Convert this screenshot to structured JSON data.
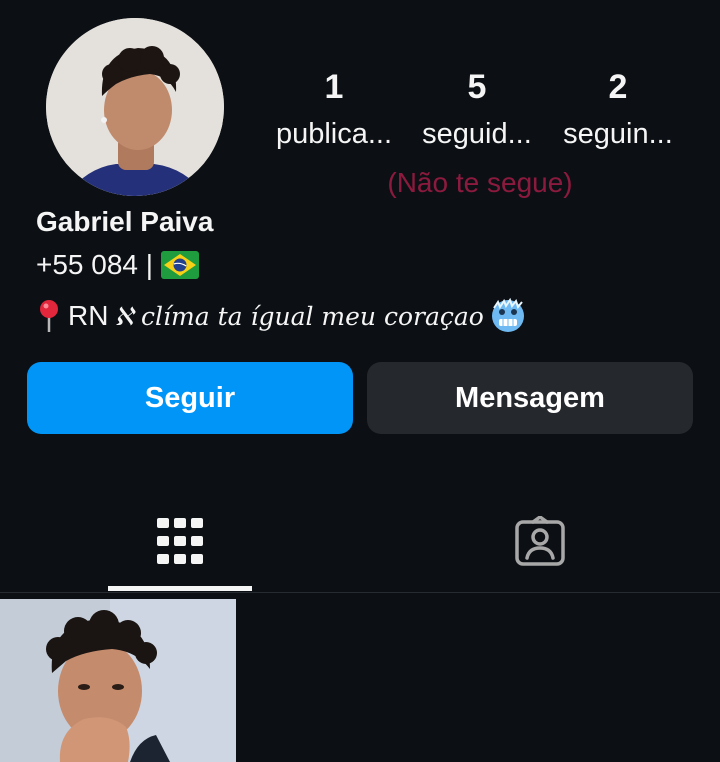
{
  "profile": {
    "avatar_alt": "profile-photo",
    "name": "Gabriel Paiva",
    "phone": "+55 084 |",
    "flag": "brazil-flag",
    "bio_prefix": "RN",
    "bio_fancy": "ℵ clíma ta ígual meu coraçao",
    "follow_status": "(Não te segue)"
  },
  "stats": [
    {
      "count": "1",
      "label": "publica..."
    },
    {
      "count": "5",
      "label": "seguid..."
    },
    {
      "count": "2",
      "label": "seguin..."
    }
  ],
  "actions": {
    "follow_label": "Seguir",
    "message_label": "Mensagem"
  },
  "tabs": [
    {
      "icon": "grid-icon",
      "active": true
    },
    {
      "icon": "tagged-icon",
      "active": false
    }
  ],
  "colors": {
    "background": "#0c1014",
    "primary": "#0095f6",
    "secondary_button": "#25292e",
    "follow_status": "#8c1a3e"
  }
}
